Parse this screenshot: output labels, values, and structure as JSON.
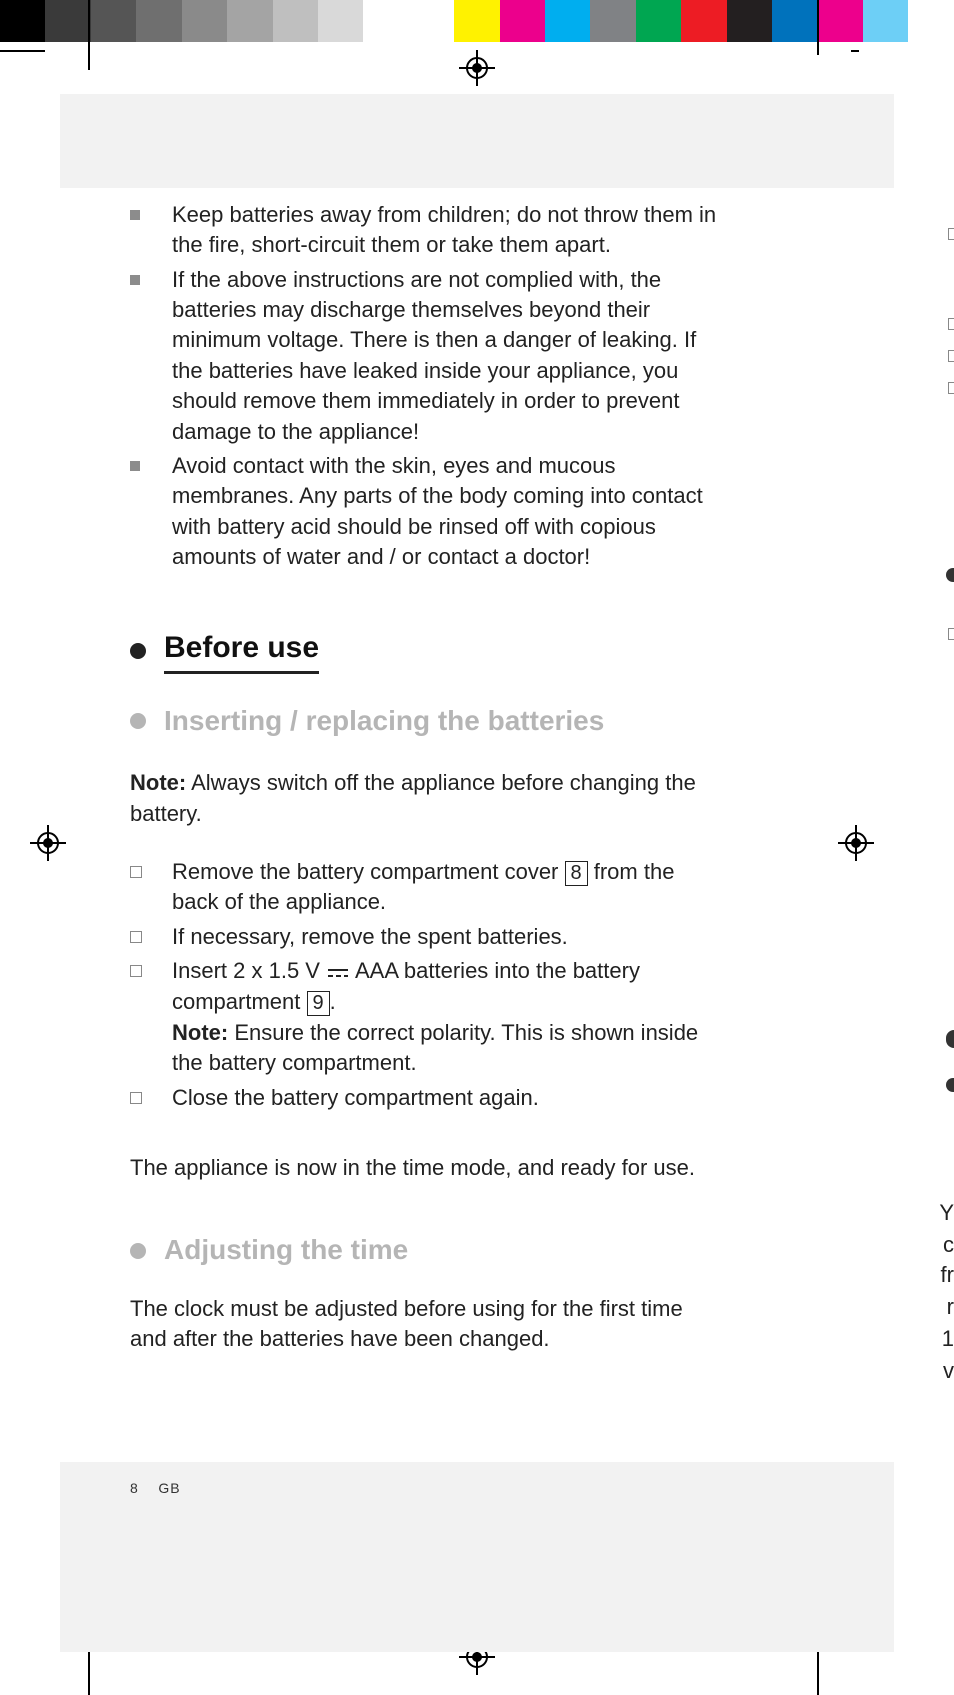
{
  "colorbar": [
    "#000000",
    "#3a3a3a",
    "#555555",
    "#6f6f6f",
    "#8a8a8a",
    "#a4a4a4",
    "#bfbfbf",
    "#d9d9d9",
    "#ffffff",
    "#ffffff",
    "#fff200",
    "#ec008c",
    "#00aeef",
    "#808285",
    "#00a651",
    "#ed1c24",
    "#231f20",
    "#0072bc",
    "#ed008c",
    "#6dcff6",
    "#ffffff"
  ],
  "safety_bullets": [
    "Keep batteries away from children; do not throw them in the fire, short-circuit them or take them apart.",
    "If the above instructions are not complied with, the batteries may discharge themselves beyond their minimum voltage. There is then a danger of leaking. If the batteries have leaked inside your appliance, you should remove them immediately in order to prevent damage to the appliance!",
    "Avoid contact with the skin, eyes and mucous membranes. Any parts of the body coming into contact with battery acid should be rinsed off with copious amounts of water and / or contact a doctor!"
  ],
  "sections": {
    "before_use": "Before use",
    "inserting": "Inserting / replacing the batteries",
    "adjusting": "Adjusting the time"
  },
  "note_label": "Note:",
  "note_text_1": " Always switch off the appliance before changing the battery.",
  "steps": {
    "s1a": "Remove the battery compartment cover ",
    "s1_ref": "8",
    "s1b": " from the back of the appliance.",
    "s2": "If necessary, remove the spent batteries.",
    "s3a": "Insert 2 x 1.5 V",
    "s3b": " AAA batteries into the battery compartment ",
    "s3_ref": "9",
    "s3c": ".",
    "s3_note": " Ensure the correct polarity. This is shown inside the battery compartment.",
    "s4": "Close the battery compartment again."
  },
  "ready_text": "The appliance is now in the time mode, and ready for use.",
  "adjust_intro": "The clock must be adjusted before using for the first time and after the batteries have been changed.",
  "footer": {
    "page": "8",
    "lang": "GB"
  },
  "edge_fragments": [
    "Y",
    "c",
    "fr",
    "r",
    "1",
    "v"
  ]
}
